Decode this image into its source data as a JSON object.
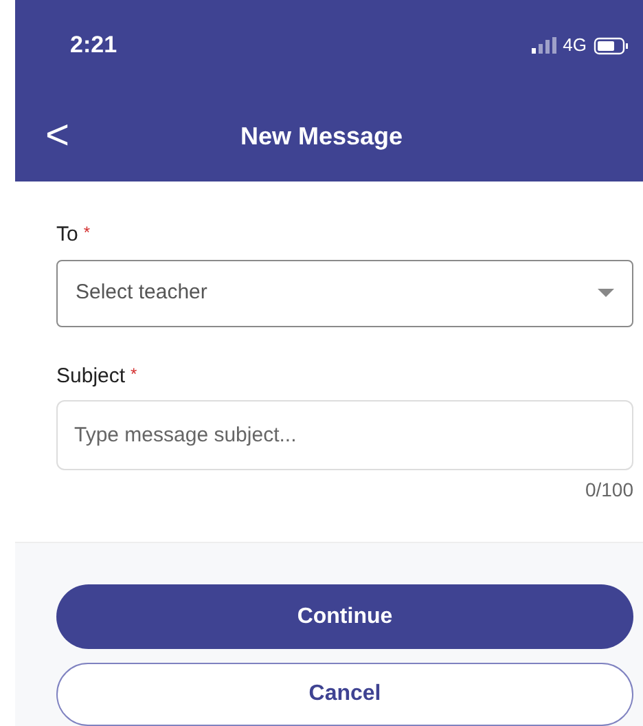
{
  "status_bar": {
    "time": "2:21",
    "network": "4G"
  },
  "header": {
    "back": "<",
    "title": "New Message"
  },
  "fields": [
    {
      "kind": "select",
      "label": "To",
      "required_mark": "*",
      "placeholder": "Select teacher"
    },
    {
      "kind": "text",
      "label": "Subject",
      "required_mark": "*",
      "placeholder": "Type message subject...",
      "counter": "0/100"
    }
  ],
  "buttons": [
    {
      "kind": "primary",
      "label": "Continue"
    },
    {
      "kind": "outline",
      "label": "Cancel"
    }
  ]
}
